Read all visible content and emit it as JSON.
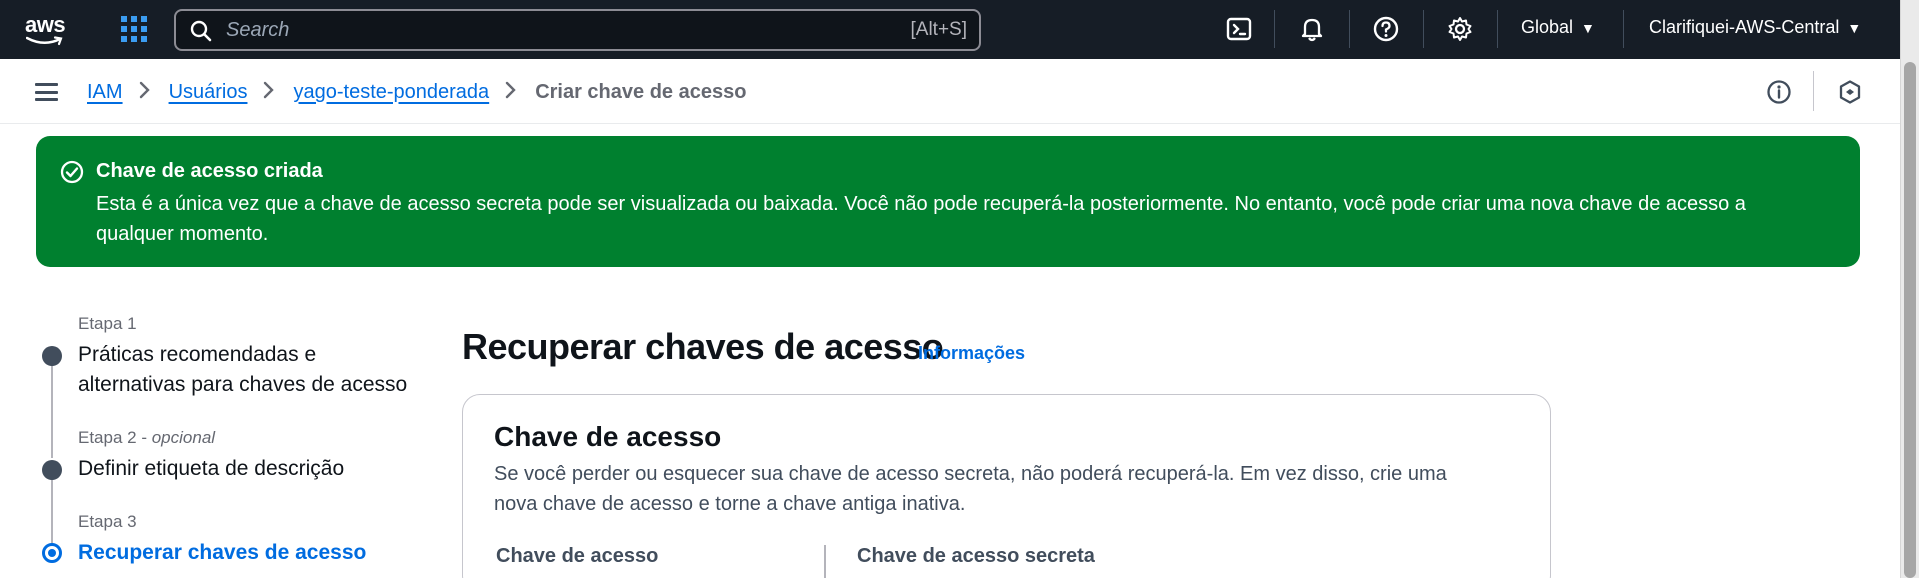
{
  "topnav": {
    "logo_text": "aws",
    "search_placeholder": "Search",
    "search_shortcut": "[Alt+S]",
    "region": "Global",
    "account": "Clarifiquei-AWS-Central"
  },
  "breadcrumb": {
    "items": [
      "IAM",
      "Usuários",
      "yago-teste-ponderada"
    ],
    "current": "Criar chave de acesso"
  },
  "flash": {
    "title": "Chave de acesso criada",
    "message": "Esta é a única vez que a chave de acesso secreta pode ser visualizada ou baixada. Você não pode recuperá-la posteriormente. No entanto, você pode criar uma nova chave de acesso a qualquer momento.",
    "color": "#00802f"
  },
  "steps": [
    {
      "number": "Etapa 1",
      "optional": "",
      "label": "Práticas recomendadas e alternativas para chaves de acesso",
      "state": "complete"
    },
    {
      "number": "Etapa 2",
      "optional": "opcional",
      "label": "Definir etiqueta de descrição",
      "state": "complete"
    },
    {
      "number": "Etapa 3",
      "optional": "",
      "label": "Recuperar chaves de acesso",
      "state": "active"
    }
  ],
  "main": {
    "heading": "Recuperar chaves de acesso",
    "info_link": "Informações",
    "card": {
      "title": "Chave de acesso",
      "description": "Se você perder ou esquecer sua chave de acesso secreta, não poderá recuperá-la. Em vez disso, crie uma nova chave de acesso e torne a chave antiga inativa.",
      "columns": [
        "Chave de acesso",
        "Chave de acesso secreta"
      ]
    }
  },
  "colors": {
    "nav_bg": "#161d26",
    "link": "#006ce0",
    "success": "#00802f"
  }
}
